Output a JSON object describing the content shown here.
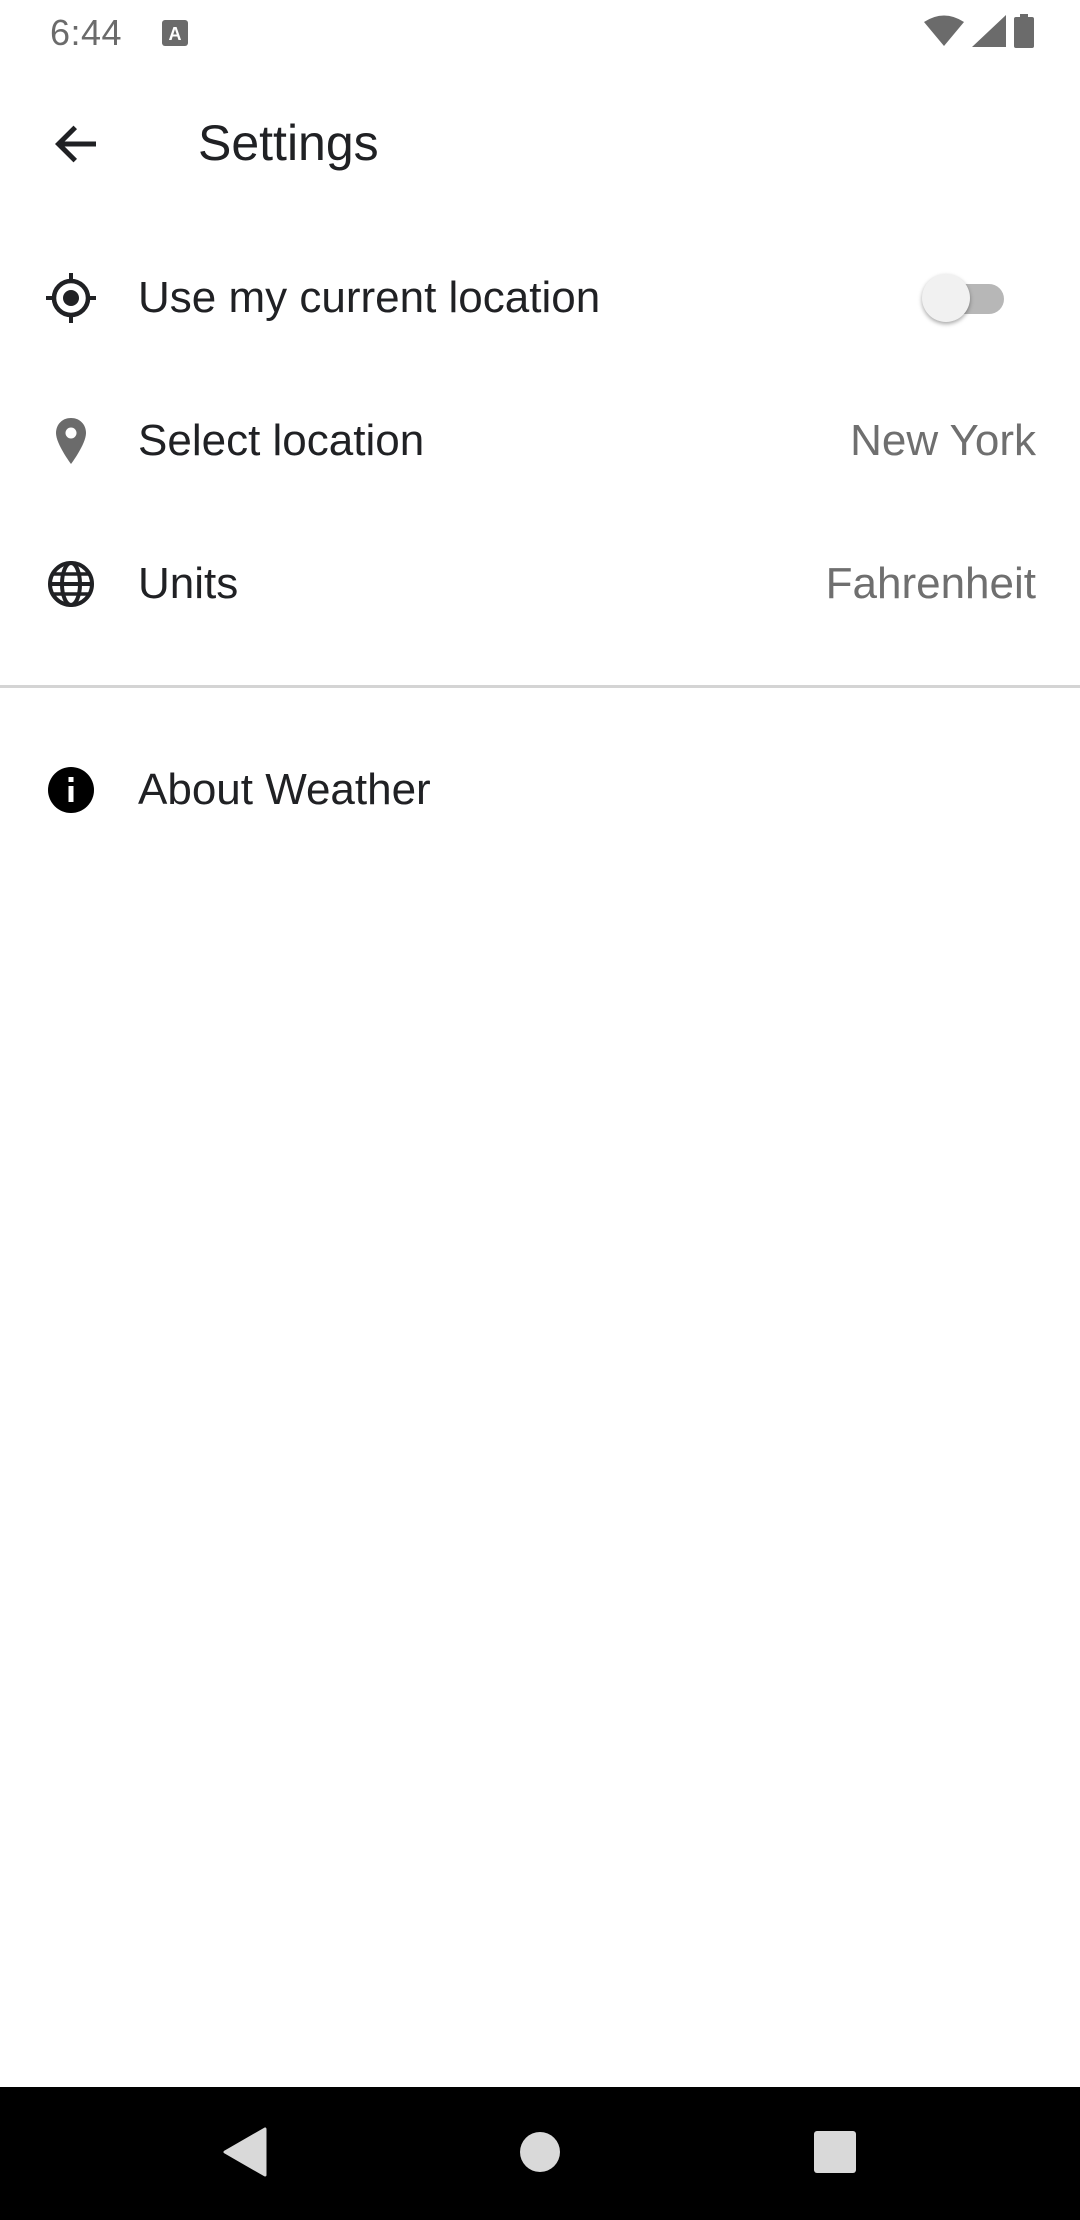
{
  "status_bar": {
    "time": "6:44",
    "icons": [
      "keyboard-a-icon",
      "wifi-icon",
      "signal-icon",
      "battery-icon"
    ]
  },
  "toolbar": {
    "title": "Settings",
    "back_icon": "arrow-back-icon"
  },
  "settings": {
    "current_location": {
      "label": "Use my current location",
      "icon": "gps-fixed-icon",
      "enabled": false
    },
    "select_location": {
      "label": "Select location",
      "icon": "location-pin-icon",
      "value": "New York"
    },
    "units": {
      "label": "Units",
      "icon": "globe-icon",
      "value": "Fahrenheit"
    },
    "about": {
      "label": "About Weather",
      "icon": "info-icon"
    }
  },
  "nav_bar": {
    "icons": [
      "nav-back-icon",
      "nav-home-icon",
      "nav-recents-icon"
    ]
  },
  "colors": {
    "text_primary": "#202124",
    "text_secondary": "#6f6f6f",
    "divider": "#d4d4d4",
    "toggle_track_off": "#b7b7b7",
    "toggle_thumb_off": "#f1f1f1",
    "nav_bar": "#000000"
  }
}
